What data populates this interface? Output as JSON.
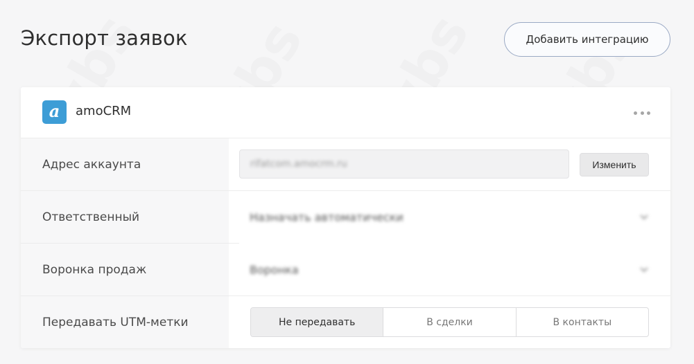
{
  "page": {
    "title": "Экспорт заявок",
    "add_integration_label": "Добавить интеграцию"
  },
  "integration": {
    "name": "amoCRM",
    "logo_letter": "a",
    "logo_color": "#3d9dd6",
    "more_icon": "more-horizontal-icon"
  },
  "fields": {
    "account_address": {
      "label": "Адрес аккаунта",
      "value": "rifatcom.amocrm.ru",
      "change_label": "Изменить"
    },
    "responsible": {
      "label": "Ответственный",
      "value": "Назначать автоматически"
    },
    "pipeline": {
      "label": "Воронка продаж",
      "value": "Воронка"
    },
    "utm": {
      "label": "Передавать UTM-метки",
      "options": [
        "Не передавать",
        "В сделки",
        "В контакты"
      ],
      "selected": "Не передавать"
    }
  },
  "watermark": {
    "text": "wbs"
  }
}
